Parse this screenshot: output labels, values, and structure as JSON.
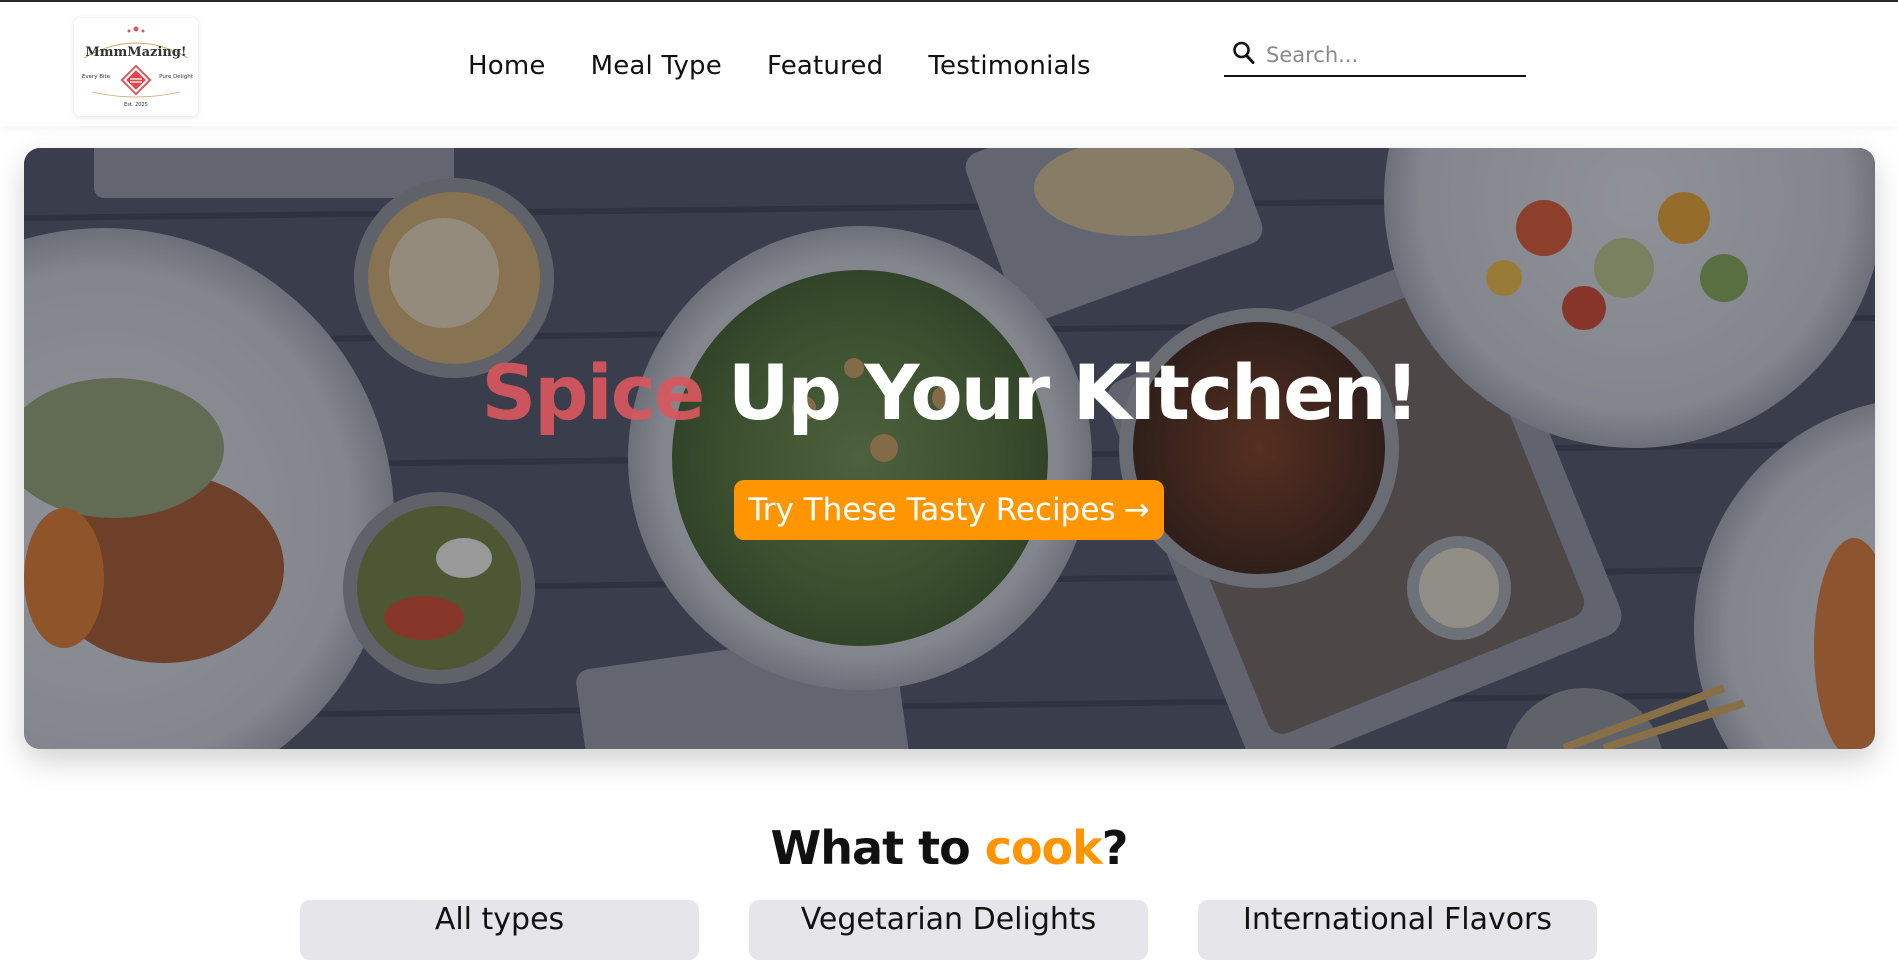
{
  "header": {
    "logo": {
      "brand": "MmmMazing!",
      "tagline_left": "Every Bite",
      "tagline_right": "Pure Delight",
      "est": "Est. 2025"
    },
    "nav": [
      "Home",
      "Meal Type",
      "Featured",
      "Testimonials"
    ],
    "search": {
      "placeholder": "Search...",
      "value": ""
    }
  },
  "hero": {
    "title_accent": "Spice",
    "title_rest": "Up Your Kitchen!",
    "cta_label": "Try These Tasty Recipes",
    "cta_arrow": "→"
  },
  "section": {
    "title_start": "What to ",
    "title_highlight": "cook",
    "title_end": "?",
    "tiles": [
      "All types",
      "Vegetarian Delights",
      "International Flavors"
    ]
  },
  "colors": {
    "accent_orange": "#ff9500",
    "accent_red": "#d9585f",
    "tile_bg": "#e6e6ea"
  },
  "icons": {
    "search": "magnifier-icon",
    "logo_emblem": "diamond-emblem-icon"
  }
}
